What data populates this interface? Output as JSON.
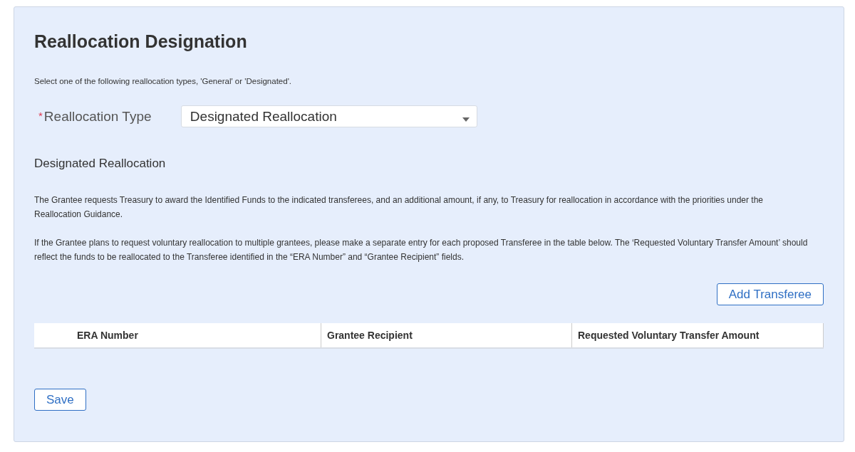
{
  "title": "Reallocation Designation",
  "intro": "Select one of the following reallocation types, 'General' or 'Designated'.",
  "field": {
    "label": "Reallocation Type",
    "required_mark": "*",
    "value": "Designated Reallocation"
  },
  "section": {
    "heading": "Designated Reallocation",
    "paragraphs": [
      "The Grantee requests Treasury to award the Identified Funds to the indicated transferees, and an additional amount, if any, to Treasury for reallocation in accordance with the priorities under the Reallocation Guidance.",
      "If the Grantee plans to request voluntary reallocation to multiple grantees, please make a separate entry for each proposed Transferee in the table below. The ‘Requested Voluntary Transfer Amount’ should reflect the funds to be reallocated to the Transferee identified in the “ERA Number” and “Grantee Recipient” fields."
    ]
  },
  "add_button": "Add Transferee",
  "table": {
    "columns": [
      "ERA Number",
      "Grantee Recipient",
      "Requested Voluntary Transfer Amount"
    ]
  },
  "save_button": "Save"
}
